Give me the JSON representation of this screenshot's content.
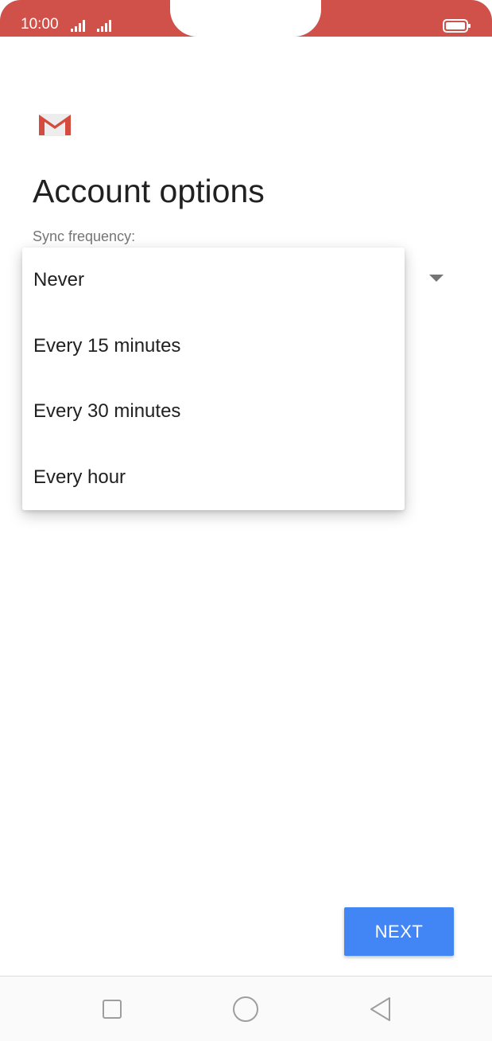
{
  "status_bar": {
    "time": "10:00",
    "icons": [
      "signal-icon",
      "signal-icon",
      "battery-icon"
    ],
    "color": "#cf5149"
  },
  "app": {
    "logo": "gmail-logo-icon"
  },
  "page": {
    "title": "Account options",
    "sync_label": "Sync frequency:"
  },
  "dropdown": {
    "options": [
      "Never",
      "Every 15 minutes",
      "Every 30 minutes",
      "Every hour"
    ],
    "arrow_icon": "dropdown-arrow-icon"
  },
  "actions": {
    "next_label": "NEXT",
    "next_color": "#4285f4"
  },
  "nav_bar": {
    "icons": [
      "recents-icon",
      "home-icon",
      "back-icon"
    ]
  }
}
